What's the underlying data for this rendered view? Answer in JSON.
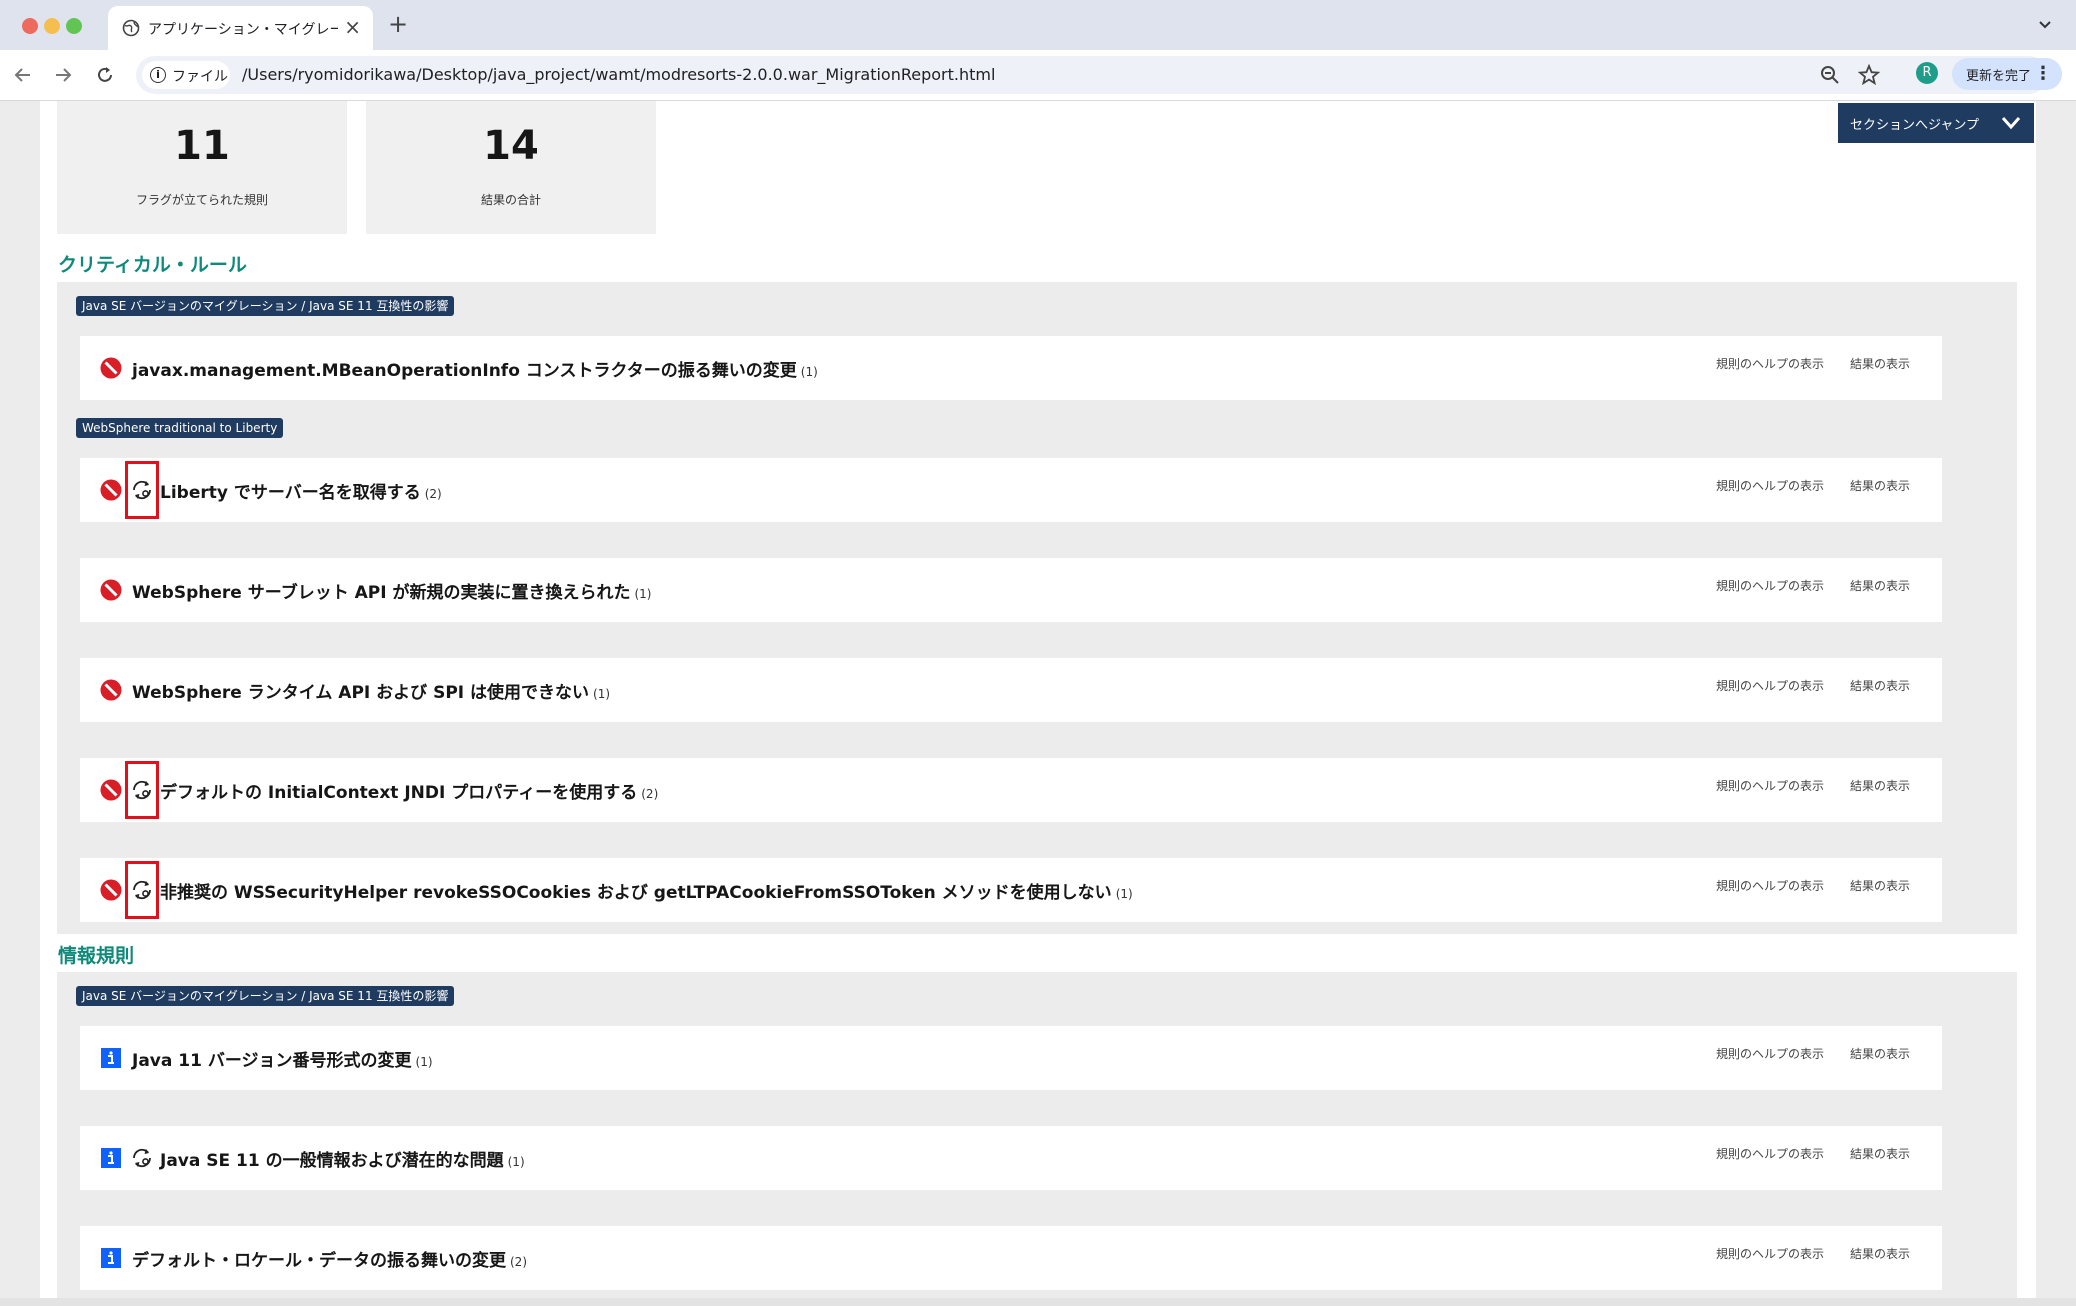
{
  "browser": {
    "tab_title": "アプリケーション・マイグレーシ",
    "tab_close": "×",
    "new_tab": "+",
    "chip_label": "ファイル",
    "url": "/Users/ryomidorikawa/Desktop/java_project/wamt/modresorts-2.0.0.war_MigrationReport.html",
    "avatar_letter": "R",
    "update_label": "更新を完了",
    "kebab": "⋮"
  },
  "stats": [
    {
      "value": "11",
      "label": "フラグが立てられた規則"
    },
    {
      "value": "14",
      "label": "結果の合計"
    }
  ],
  "jump_label": "セクションへジャンプ",
  "sections": {
    "critical": {
      "title": "クリティカル・ルール",
      "tags": [
        "Java SE バージョンのマイグレーション / Java SE 11 互換性の影響",
        "WebSphere traditional to Liberty"
      ],
      "rows": [
        {
          "text": "javax.management.MBeanOperationInfo コンストラクターの振る舞いの変更",
          "count": "(1)"
        },
        {
          "text": "Liberty でサーバー名を取得する",
          "count": "(2)"
        },
        {
          "text": "WebSphere サーブレット API が新規の実装に置き換えられた",
          "count": "(1)"
        },
        {
          "text": "WebSphere ランタイム API および SPI は使用できない",
          "count": "(1)"
        },
        {
          "text": "デフォルトの InitialContext JNDI プロパティーを使用する",
          "count": "(2)"
        },
        {
          "text": "非推奨の WSSecurityHelper revokeSSOCookies および getLTPACookieFromSSOToken メソッドを使用しない",
          "count": "(1)"
        }
      ]
    },
    "info": {
      "title": "情報規則",
      "tags": [
        "Java SE バージョンのマイグレーション / Java SE 11 互換性の影響"
      ],
      "rows": [
        {
          "text": "Java 11 バージョン番号形式の変更",
          "count": "(1)"
        },
        {
          "text": "Java SE 11 の一般情報および潜在的な問題",
          "count": "(1)"
        },
        {
          "text": "デフォルト・ロケール・データの振る舞いの変更",
          "count": "(2)"
        }
      ]
    }
  },
  "links": {
    "help": "規則のヘルプの表示",
    "results": "結果の表示"
  },
  "colors": {
    "critical": "#da1e28",
    "info": "#0f62fe",
    "tag_bg": "#1f3c60",
    "section_title": "#0f8a7a",
    "highlight": "#e0101c"
  }
}
